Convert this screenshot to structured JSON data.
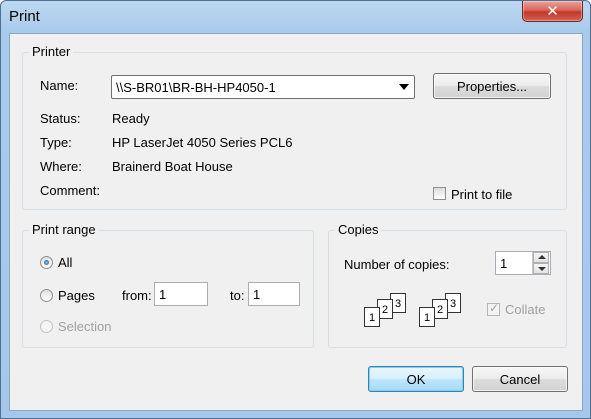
{
  "window": {
    "title": "Print",
    "close_label": "✕"
  },
  "printer": {
    "legend": "Printer",
    "name_label": "Name:",
    "name_value": "\\\\S-BR01\\BR-BH-HP4050-1",
    "properties_label": "Properties...",
    "status_label": "Status:",
    "status_value": "Ready",
    "type_label": "Type:",
    "type_value": "HP LaserJet 4050 Series PCL6",
    "where_label": "Where:",
    "where_value": "Brainerd Boat House",
    "comment_label": "Comment:",
    "comment_value": "",
    "print_to_file_label": "Print to file",
    "print_to_file_checked": false
  },
  "print_range": {
    "legend": "Print range",
    "all_label": "All",
    "pages_label": "Pages",
    "from_label": "from:",
    "from_value": "1",
    "to_label": "to:",
    "to_value": "1",
    "selection_label": "Selection",
    "selected": "all"
  },
  "copies": {
    "legend": "Copies",
    "number_label": "Number of copies:",
    "number_value": "1",
    "collate_label": "Collate",
    "collate_checked": true,
    "collate_pages": [
      "1",
      "2",
      "3"
    ]
  },
  "buttons": {
    "ok_label": "OK",
    "cancel_label": "Cancel"
  }
}
